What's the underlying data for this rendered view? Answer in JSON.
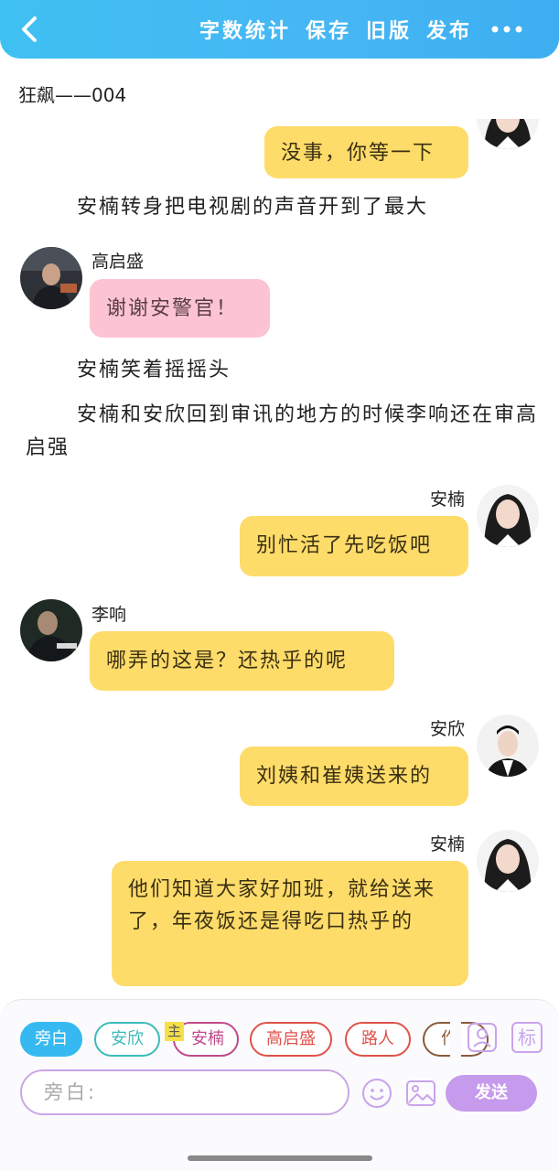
{
  "header": {
    "word_count": "字数统计",
    "save": "保存",
    "old_version": "旧版",
    "publish": "发布",
    "colors": {
      "bg": "#42b6f3",
      "text": "#ffffff"
    }
  },
  "document": {
    "title": "狂飙——004"
  },
  "messages": [
    {
      "type": "bubble",
      "side": "right",
      "text": "没事，你等一下",
      "color": "#fedc6a"
    },
    {
      "type": "narration",
      "text": "安楠转身把电视剧的声音开到了最大"
    },
    {
      "type": "bubble",
      "side": "left",
      "speaker": "高启盛",
      "text": "谢谢安警官！",
      "color": "#fcc4d2"
    },
    {
      "type": "narration",
      "text": "安楠笑着摇摇头"
    },
    {
      "type": "narration",
      "text": "安楠和安欣回到审讯的地方的时候李响还在审高启强"
    },
    {
      "type": "bubble",
      "side": "right",
      "speaker": "安楠",
      "text": "别忙活了先吃饭吧",
      "color": "#fedc6a"
    },
    {
      "type": "bubble",
      "side": "left",
      "speaker": "李响",
      "text": "哪弄的这是？还热乎的呢",
      "color": "#fedc6a"
    },
    {
      "type": "bubble",
      "side": "right",
      "speaker": "安欣",
      "text": "刘姨和崔姨送来的",
      "color": "#fedc6a"
    },
    {
      "type": "bubble",
      "side": "right",
      "speaker": "安楠",
      "text": "他们知道大家好加班，就给送来了，年夜饭还是得吃口热乎的",
      "color": "#fedc6a"
    }
  ],
  "role_chips": [
    {
      "label": "旁白",
      "color": "#36b9f1",
      "selected": true
    },
    {
      "label": "安欣",
      "color": "#3cbcb8"
    },
    {
      "label": "安楠",
      "color": "#c04a8a"
    },
    {
      "label": "高启盛",
      "color": "#e0524a"
    },
    {
      "label": "路人",
      "color": "#e0524a"
    },
    {
      "label": "作",
      "color": "#8a5a3a"
    }
  ],
  "main_tag": "主",
  "tools": {
    "role_icon": "user-card-icon",
    "tag_label": "标",
    "emoji_icon": "smile-icon",
    "image_icon": "image-icon"
  },
  "input": {
    "placeholder": "旁白:"
  },
  "send_label": "发送"
}
